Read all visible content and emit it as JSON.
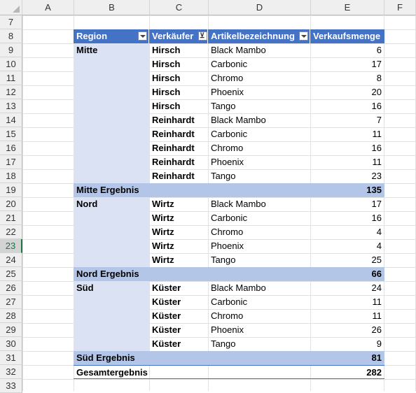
{
  "columns": [
    "A",
    "B",
    "C",
    "D",
    "E",
    "F"
  ],
  "rows": [
    7,
    8,
    9,
    10,
    11,
    12,
    13,
    14,
    15,
    16,
    17,
    18,
    19,
    20,
    21,
    22,
    23,
    24,
    25,
    26,
    27,
    28,
    29,
    30,
    31,
    32,
    33
  ],
  "active_row": 23,
  "pivot": {
    "headers": {
      "region": "Region",
      "seller": "Verkäufer",
      "article": "Artikelbezeichnung",
      "qty": "Verkaufsmenge"
    },
    "lines": [
      {
        "region": "Mitte",
        "seller": "Hirsch",
        "article": "Black Mambo",
        "qty": "6"
      },
      {
        "region": "",
        "seller": "Hirsch",
        "article": "Carbonic",
        "qty": "17"
      },
      {
        "region": "",
        "seller": "Hirsch",
        "article": "Chromo",
        "qty": "8"
      },
      {
        "region": "",
        "seller": "Hirsch",
        "article": "Phoenix",
        "qty": "20"
      },
      {
        "region": "",
        "seller": "Hirsch",
        "article": "Tango",
        "qty": "16"
      },
      {
        "region": "",
        "seller": "Reinhardt",
        "article": "Black Mambo",
        "qty": "7"
      },
      {
        "region": "",
        "seller": "Reinhardt",
        "article": "Carbonic",
        "qty": "11"
      },
      {
        "region": "",
        "seller": "Reinhardt",
        "article": "Chromo",
        "qty": "16"
      },
      {
        "region": "",
        "seller": "Reinhardt",
        "article": "Phoenix",
        "qty": "11"
      },
      {
        "region": "",
        "seller": "Reinhardt",
        "article": "Tango",
        "qty": "23"
      },
      {
        "subtotal": "Mitte Ergebnis",
        "qty": "135"
      },
      {
        "region": "Nord",
        "seller": "Wirtz",
        "article": "Black Mambo",
        "qty": "17"
      },
      {
        "region": "",
        "seller": "Wirtz",
        "article": "Carbonic",
        "qty": "16"
      },
      {
        "region": "",
        "seller": "Wirtz",
        "article": "Chromo",
        "qty": "4"
      },
      {
        "region": "",
        "seller": "Wirtz",
        "article": "Phoenix",
        "qty": "4"
      },
      {
        "region": "",
        "seller": "Wirtz",
        "article": "Tango",
        "qty": "25"
      },
      {
        "subtotal": "Nord Ergebnis",
        "qty": "66"
      },
      {
        "region": "Süd",
        "seller": "Küster",
        "article": "Black Mambo",
        "qty": "24"
      },
      {
        "region": "",
        "seller": "Küster",
        "article": "Carbonic",
        "qty": "11"
      },
      {
        "region": "",
        "seller": "Küster",
        "article": "Chromo",
        "qty": "11"
      },
      {
        "region": "",
        "seller": "Küster",
        "article": "Phoenix",
        "qty": "26"
      },
      {
        "region": "",
        "seller": "Küster",
        "article": "Tango",
        "qty": "9"
      },
      {
        "subtotal": "Süd Ergebnis",
        "qty": "81"
      },
      {
        "grandtotal": "Gesamtergebnis",
        "qty": "282"
      }
    ]
  },
  "colors": {
    "header": "#4472c4",
    "region_fill": "#dae2f3",
    "subtotal_fill": "#b4c6e7",
    "active": "#217346"
  },
  "icons": {
    "dropdown": "dropdown-arrow-icon",
    "filter": "filter-icon"
  }
}
